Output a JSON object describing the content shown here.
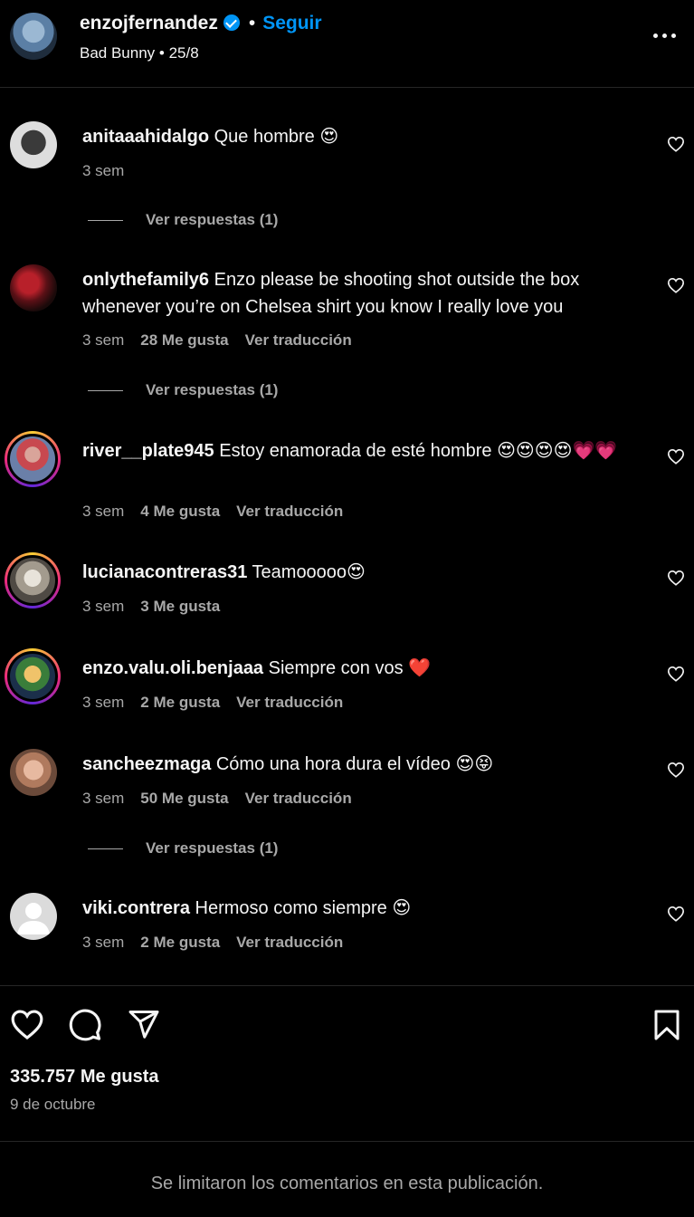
{
  "header": {
    "username": "enzojfernandez",
    "separator": "•",
    "follow_label": "Seguir",
    "subtitle": "Bad Bunny • 25/8"
  },
  "comments": [
    {
      "username": "anitaaahidalgo",
      "text": "Que hombre 😍",
      "time": "3 sem",
      "likes": "",
      "translate": "",
      "replies": "Ver respuestas (1)"
    },
    {
      "username": "onlythefamily6",
      "text": "Enzo please be shooting shot outside the box whenever you’re on Chelsea shirt you know I really love you",
      "time": "3 sem",
      "likes": "28 Me gusta",
      "translate": "Ver traducción",
      "replies": "Ver respuestas (1)"
    },
    {
      "username": "river__plate945",
      "text": "Estoy enamorada de esté hombre 😍😍😍😍💗💗",
      "time": "3 sem",
      "likes": "4 Me gusta",
      "translate": "Ver traducción",
      "replies": ""
    },
    {
      "username": "lucianacontreras31",
      "text": "Teamooooo😍",
      "time": "3 sem",
      "likes": "3 Me gusta",
      "translate": "",
      "replies": ""
    },
    {
      "username": "enzo.valu.oli.benjaaa",
      "text": "Siempre con vos ❤️",
      "time": "3 sem",
      "likes": "2 Me gusta",
      "translate": "Ver traducción",
      "replies": ""
    },
    {
      "username": "sancheezmaga",
      "text": "Cómo una hora dura el vídeo 😍😝",
      "time": "3 sem",
      "likes": "50 Me gusta",
      "translate": "Ver traducción",
      "replies": "Ver respuestas (1)"
    },
    {
      "username": "viki.contrera",
      "text": "Hermoso como siempre 😍",
      "time": "3 sem",
      "likes": "2 Me gusta",
      "translate": "Ver traducción",
      "replies": ""
    }
  ],
  "post": {
    "likes": "335.757 Me gusta",
    "date": "9 de octubre"
  },
  "footer": {
    "limited_comments": "Se limitaron los comentarios en esta publicación."
  },
  "colors": {
    "background": "#000000",
    "text": "#f5f5f5",
    "muted": "#a8a8a8",
    "accent": "#0095f6",
    "divider": "#262626"
  },
  "icons": [
    "verified-badge-icon",
    "more-options-icon",
    "heart-icon",
    "comment-icon",
    "share-icon",
    "bookmark-icon"
  ]
}
